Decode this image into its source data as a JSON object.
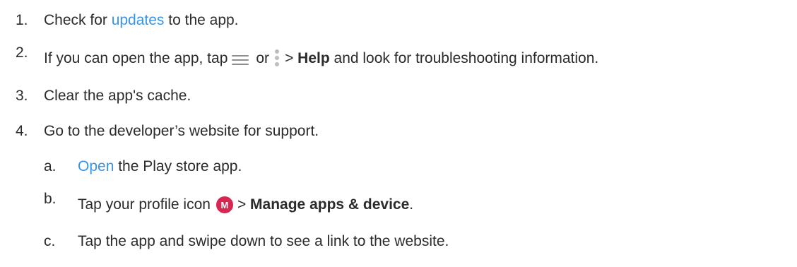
{
  "steps": [
    {
      "number": "1.",
      "pre": "Check for ",
      "link": "updates",
      "post": " to the app."
    },
    {
      "number": "2.",
      "pre": "If you can open the app, tap",
      "mid": "or",
      "sep": ">",
      "bold": "Help",
      "post": " and look for troubleshooting information."
    },
    {
      "number": "3.",
      "text": "Clear the app's cache."
    },
    {
      "number": "4.",
      "text": "Go to the developer’s website for support."
    }
  ],
  "substeps": [
    {
      "letter": "a.",
      "link": "Open",
      "post": " the Play store app."
    },
    {
      "letter": "b.",
      "pre": "Tap your profile icon",
      "avatar_letter": "M",
      "sep": ">",
      "bold": "Manage apps & device",
      "post": "."
    },
    {
      "letter": "c.",
      "text": "Tap the app and swipe down to see a link to the website."
    }
  ],
  "icons": {
    "menu": "hamburger-menu-icon",
    "more": "more-vert-icon",
    "avatar_color": "#d7264f"
  },
  "colors": {
    "link": "#3a94e6",
    "text": "#2b2b2b"
  }
}
